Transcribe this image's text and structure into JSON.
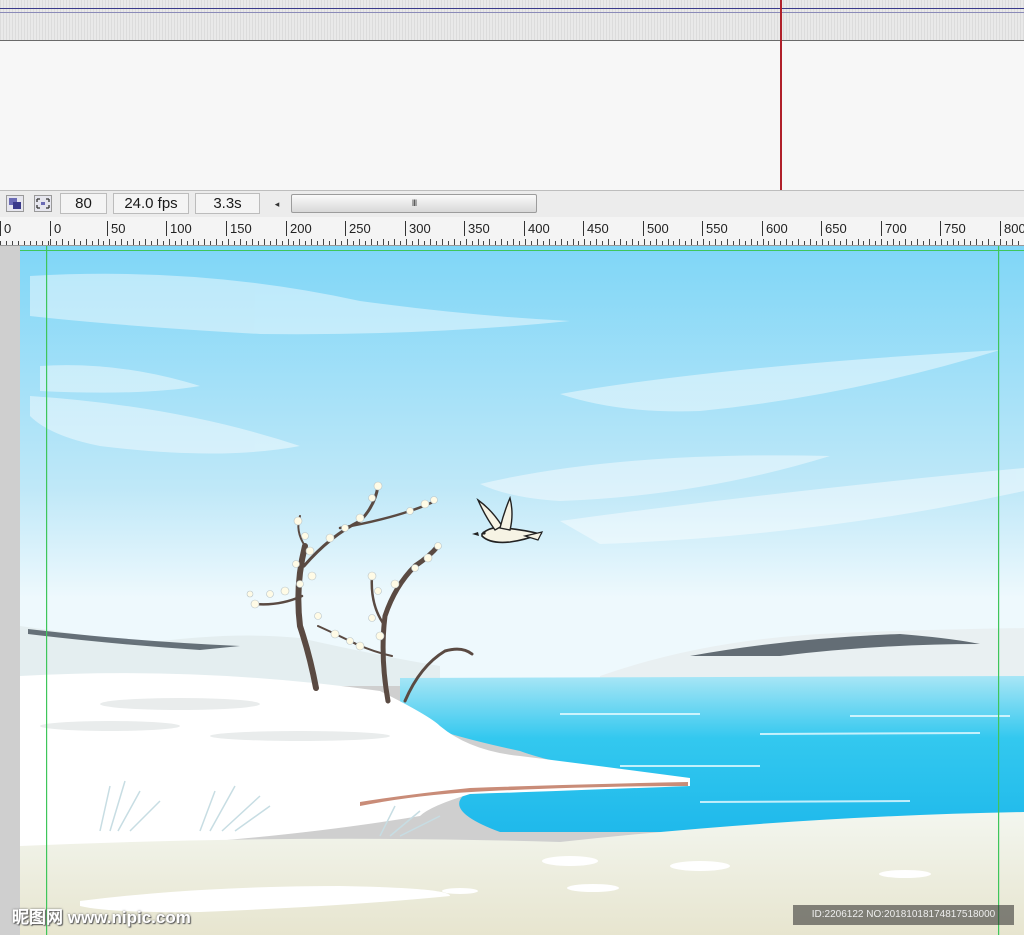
{
  "status_bar": {
    "frame": "80",
    "fps": "24.0 fps",
    "time": "3.3s",
    "scroll_left_glyph": "◂",
    "scroll_thumb_grip": "III"
  },
  "ruler": {
    "labels": [
      "0",
      "0",
      "50",
      "100",
      "150",
      "200",
      "250",
      "300",
      "350",
      "400",
      "450",
      "500",
      "550",
      "600",
      "650",
      "700",
      "750",
      "800"
    ]
  },
  "icons": {
    "onion_skin": "onion-skin-icon",
    "center_frame": "center-frame-icon"
  },
  "colors": {
    "sky_top": "#7fd6f7",
    "sky_bottom": "#eaf7fc",
    "water": "#2ec7ef",
    "snow": "#ffffff",
    "playhead": "#b0202a",
    "guide": "#3ec65a"
  },
  "watermarks": {
    "left": "昵图网 www.nipic.com",
    "right": "ID:2206122 NO:20181018174817518000"
  }
}
